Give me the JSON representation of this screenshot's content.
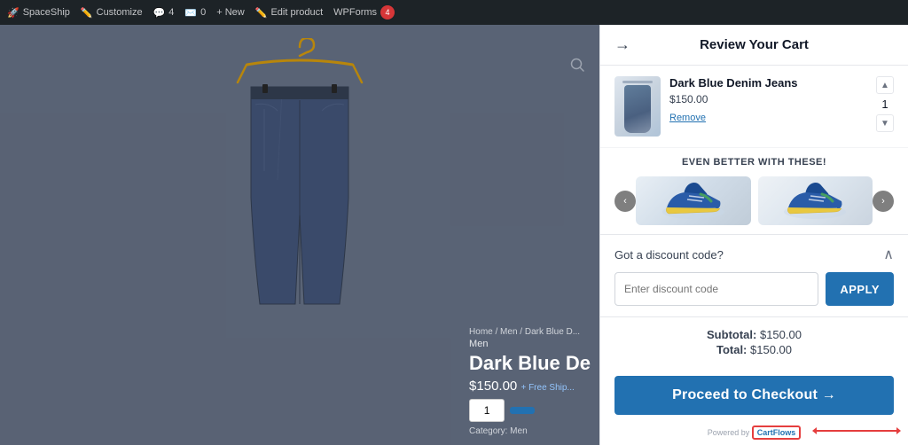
{
  "admin_bar": {
    "site_name": "SpaceShip",
    "customize": "Customize",
    "comments_count": "4",
    "messages_count": "0",
    "new_label": "+ New",
    "edit_product": "Edit product",
    "wpforms": "WPForms",
    "wpforms_badge": "4"
  },
  "product_page": {
    "breadcrumb": "Home / Men / Dark Blue D...",
    "category": "Men",
    "title_partial": "Dark Blue De",
    "price": "$150.00",
    "free_shipping": "+ Free Ship...",
    "qty_value": "1",
    "category_label": "Category: Men"
  },
  "cart": {
    "title": "Review Your Cart",
    "back_arrow": "→",
    "item": {
      "name": "Dark Blue Denim Jeans",
      "price": "$150.00",
      "remove_label": "Remove",
      "quantity": "1"
    },
    "upsell": {
      "title": "EVEN BETTER WITH THESE!"
    },
    "discount": {
      "label": "Got a discount code?",
      "placeholder": "Enter discount code",
      "apply_label": "APPLY"
    },
    "totals": {
      "subtotal_label": "Subtotal:",
      "subtotal_value": "$150.00",
      "total_label": "Total:",
      "total_value": "$150.00"
    },
    "checkout_button": "Proceed to Checkout →",
    "powered_by_text": "Powered by",
    "powered_by_brand": "CartFlows"
  }
}
